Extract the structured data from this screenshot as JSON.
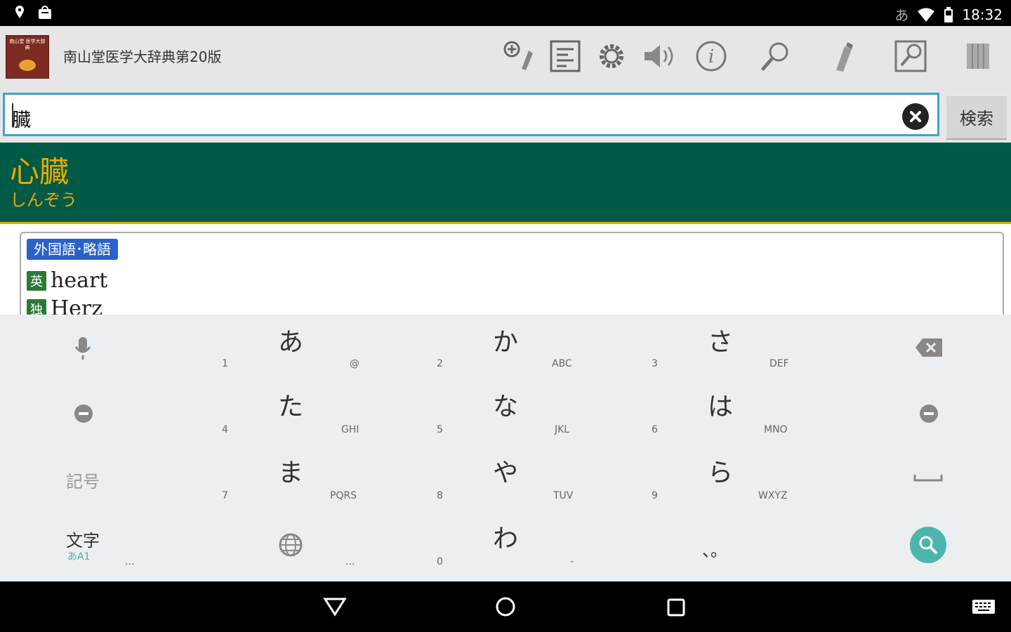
{
  "status_bar": {
    "ime_indicator": "あ",
    "time": "18:32",
    "icons": [
      "location-icon",
      "store-icon",
      "wifi-icon",
      "battery-icon"
    ]
  },
  "app_bar": {
    "title": "南山堂医学大辞典第20版",
    "logo_text": "南山堂 医学大辞典",
    "actions": [
      "add-bookmark-icon",
      "list-icon",
      "settings-icon",
      "speaker-icon",
      "info-icon",
      "search-icon",
      "marker-icon",
      "zoom-search-icon",
      "book-icon"
    ]
  },
  "search": {
    "value": "臓",
    "button_label": "検索"
  },
  "entry": {
    "headword": "心臓",
    "reading": "しんぞう",
    "section_tag": "外国語･略語",
    "translations": [
      {
        "lang": "英",
        "term": "heart"
      },
      {
        "lang": "独",
        "term": "Herz"
      }
    ]
  },
  "colors": {
    "header_band": "#005a45",
    "accent_orange": "#e8a800",
    "search_border": "#3aa6c9",
    "tag_blue": "#2a62c9",
    "lang_green": "#2a7a35",
    "search_fab": "#4db6ac"
  },
  "keyboard": {
    "left_keys": {
      "symbols": "記号",
      "mode_main": "文字",
      "mode_sub": "あA1"
    },
    "rows": [
      [
        {
          "kana": "あ",
          "num": "1",
          "sub": "@"
        },
        {
          "kana": "か",
          "num": "2",
          "sub": "ABC"
        },
        {
          "kana": "さ",
          "num": "3",
          "sub": "DEF"
        }
      ],
      [
        {
          "kana": "た",
          "num": "4",
          "sub": "GHI"
        },
        {
          "kana": "な",
          "num": "5",
          "sub": "JKL"
        },
        {
          "kana": "は",
          "num": "6",
          "sub": "MNO"
        }
      ],
      [
        {
          "kana": "ま",
          "num": "7",
          "sub": "PQRS"
        },
        {
          "kana": "や",
          "num": "8",
          "sub": "TUV"
        },
        {
          "kana": "ら",
          "num": "9",
          "sub": "WXYZ"
        }
      ]
    ],
    "bottom": {
      "wa": "わ",
      "zero": "0",
      "punct": "、。",
      "dash": "-",
      "dots_left": "...",
      "dots_mid": "..."
    }
  }
}
